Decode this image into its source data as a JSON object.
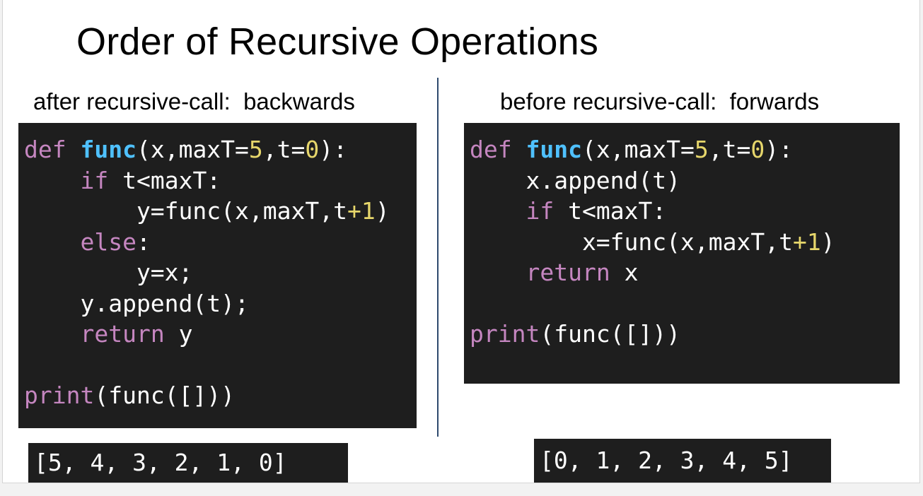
{
  "title": "Order of Recursive Operations",
  "left": {
    "subtitle": "after recursive-call:  backwards",
    "code": [
      {
        "parts": [
          {
            "t": "def ",
            "c": "kw"
          },
          {
            "t": "func",
            "c": "fn"
          },
          {
            "t": "(x,maxT="
          },
          {
            "t": "5",
            "c": "num"
          },
          {
            "t": ",t="
          },
          {
            "t": "0",
            "c": "num"
          },
          {
            "t": "):"
          }
        ]
      },
      {
        "parts": [
          {
            "t": "    "
          },
          {
            "t": "if",
            "c": "kw"
          },
          {
            "t": " t<maxT:"
          }
        ]
      },
      {
        "parts": [
          {
            "t": "        y=func(x,maxT,t"
          },
          {
            "t": "+1",
            "c": "num"
          },
          {
            "t": ")"
          }
        ]
      },
      {
        "parts": [
          {
            "t": "    "
          },
          {
            "t": "else",
            "c": "kw"
          },
          {
            "t": ":"
          }
        ]
      },
      {
        "parts": [
          {
            "t": "        y=x;"
          }
        ]
      },
      {
        "parts": [
          {
            "t": "    y.append(t);"
          }
        ]
      },
      {
        "parts": [
          {
            "t": "    "
          },
          {
            "t": "return",
            "c": "kw"
          },
          {
            "t": " y"
          }
        ]
      },
      {
        "parts": [
          {
            "t": ""
          }
        ]
      },
      {
        "parts": [
          {
            "t": "print",
            "c": "kw"
          },
          {
            "t": "(func([]))"
          }
        ]
      }
    ],
    "output": "[5, 4, 3, 2, 1, 0]"
  },
  "right": {
    "subtitle": "before recursive-call:  forwards",
    "code": [
      {
        "parts": [
          {
            "t": "def ",
            "c": "kw"
          },
          {
            "t": "func",
            "c": "fn"
          },
          {
            "t": "(x,maxT="
          },
          {
            "t": "5",
            "c": "num"
          },
          {
            "t": ",t="
          },
          {
            "t": "0",
            "c": "num"
          },
          {
            "t": "):"
          }
        ]
      },
      {
        "parts": [
          {
            "t": "    x.append(t)"
          }
        ]
      },
      {
        "parts": [
          {
            "t": "    "
          },
          {
            "t": "if",
            "c": "kw"
          },
          {
            "t": " t<maxT:"
          }
        ]
      },
      {
        "parts": [
          {
            "t": "        x=func(x,maxT,t"
          },
          {
            "t": "+1",
            "c": "num"
          },
          {
            "t": ")"
          }
        ]
      },
      {
        "parts": [
          {
            "t": "    "
          },
          {
            "t": "return",
            "c": "kw"
          },
          {
            "t": " x"
          }
        ]
      },
      {
        "parts": [
          {
            "t": ""
          }
        ]
      },
      {
        "parts": [
          {
            "t": "print",
            "c": "kw"
          },
          {
            "t": "(func([]))"
          }
        ]
      }
    ],
    "output": "[0, 1, 2, 3, 4, 5]"
  },
  "colors": {
    "code_bg": "#1e1e1e",
    "keyword": "#c586c0",
    "function": "#4fc1ff",
    "number": "#e6d66b",
    "divider": "#2e4a6e"
  }
}
